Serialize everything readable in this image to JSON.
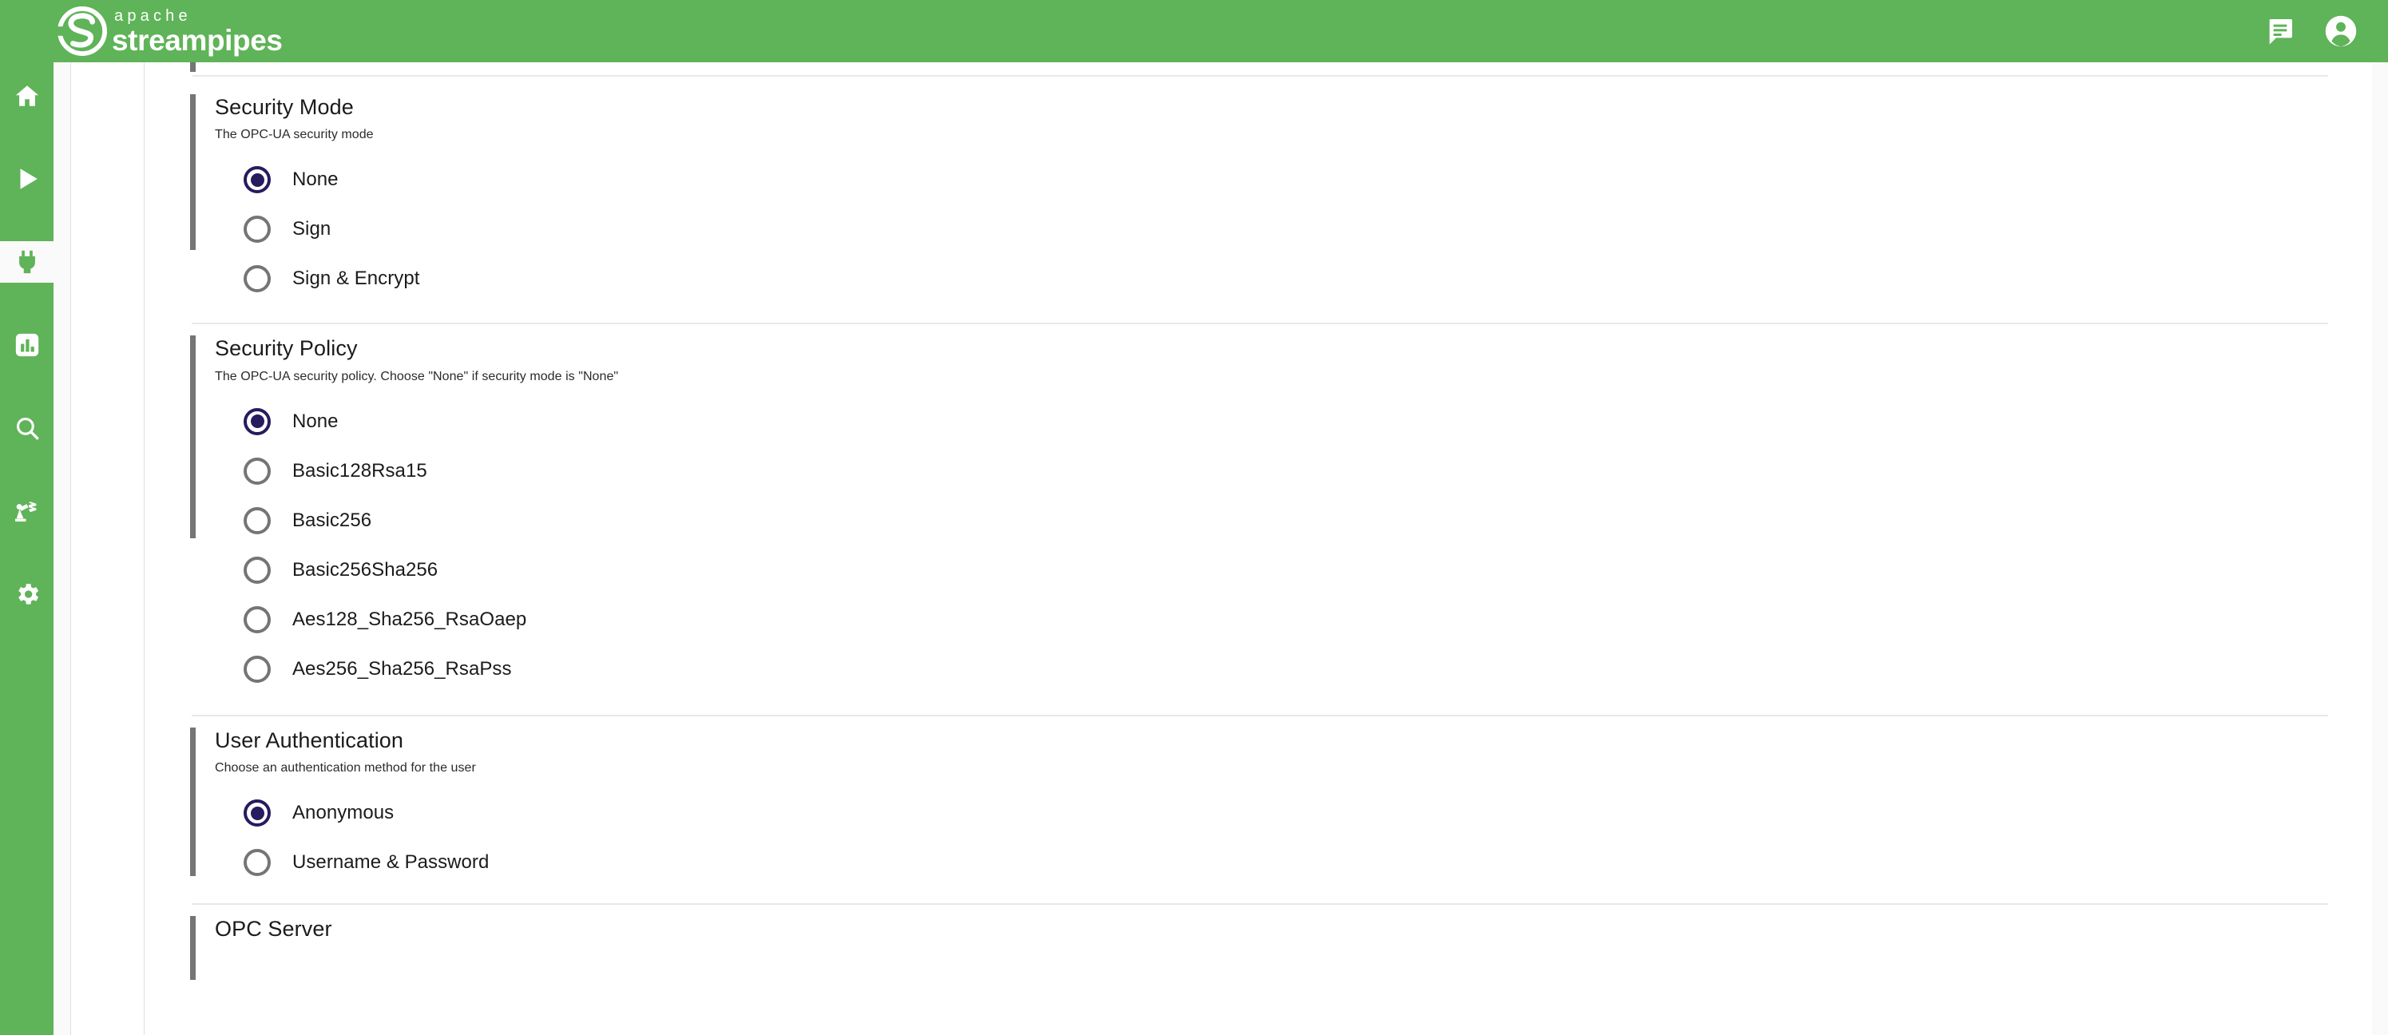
{
  "app": {
    "brand_apache": "apache",
    "brand_name": "streampipes",
    "accent_green": "#5fb358",
    "selected_radio_color": "#261c5e",
    "unselected_radio_color": "#757575"
  },
  "topbar": {
    "icons": [
      {
        "name": "messages-icon",
        "label": "Messages"
      },
      {
        "name": "account-icon",
        "label": "Account"
      }
    ]
  },
  "sidebar": {
    "items": [
      {
        "name": "home",
        "label": "Home",
        "icon": "home-icon",
        "active": false
      },
      {
        "name": "pipelines",
        "label": "Pipelines",
        "icon": "play-icon",
        "active": false
      },
      {
        "name": "connect",
        "label": "Connect",
        "icon": "plug-icon",
        "active": true
      },
      {
        "name": "dashboard",
        "label": "Dashboard",
        "icon": "chart-bar-icon",
        "active": false
      },
      {
        "name": "explore",
        "label": "Data Explorer",
        "icon": "search-icon",
        "active": false
      },
      {
        "name": "assets",
        "label": "Assets",
        "icon": "robot-arm-icon",
        "active": false
      },
      {
        "name": "configuration",
        "label": "Configuration",
        "icon": "gear-icon",
        "active": false
      }
    ]
  },
  "form": {
    "sections": [
      {
        "id": "security-mode",
        "title": "Security Mode",
        "description": "The OPC-UA security mode",
        "options": [
          {
            "label": "None",
            "checked": true
          },
          {
            "label": "Sign",
            "checked": false
          },
          {
            "label": "Sign & Encrypt",
            "checked": false
          }
        ]
      },
      {
        "id": "security-policy",
        "title": "Security Policy",
        "description": "The OPC-UA security policy. Choose \"None\" if security mode is \"None\"",
        "options": [
          {
            "label": "None",
            "checked": true
          },
          {
            "label": "Basic128Rsa15",
            "checked": false
          },
          {
            "label": "Basic256",
            "checked": false
          },
          {
            "label": "Basic256Sha256",
            "checked": false
          },
          {
            "label": "Aes128_Sha256_RsaOaep",
            "checked": false
          },
          {
            "label": "Aes256_Sha256_RsaPss",
            "checked": false
          }
        ]
      },
      {
        "id": "user-authentication",
        "title": "User Authentication",
        "description": "Choose an authentication method for the user",
        "options": [
          {
            "label": "Anonymous",
            "checked": true
          },
          {
            "label": "Username & Password",
            "checked": false
          }
        ]
      },
      {
        "id": "opc-server",
        "title": "OPC Server",
        "description": "",
        "options": []
      }
    ]
  }
}
